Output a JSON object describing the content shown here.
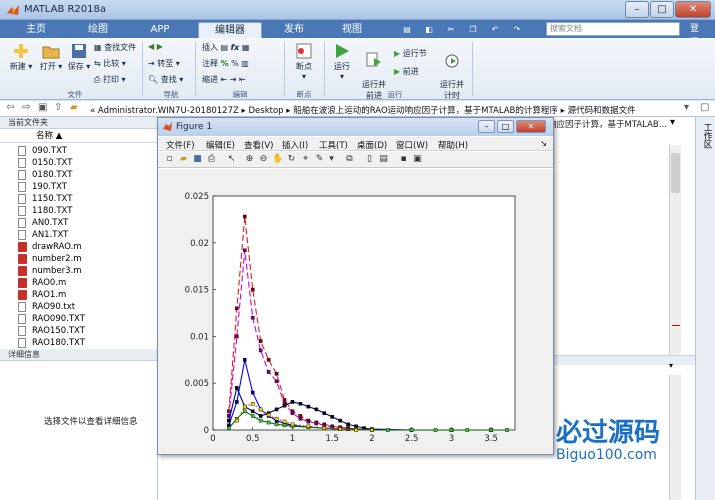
{
  "app": {
    "title": "MATLAB R2018a"
  },
  "window_buttons": {
    "minimize": "–",
    "maximize": "□",
    "close": "✕"
  },
  "ribbon_tabs": [
    "主页",
    "绘图",
    "APP",
    "编辑器",
    "发布",
    "视图"
  ],
  "active_tab": "编辑器",
  "search": {
    "placeholder": "搜索文档"
  },
  "login": "登录",
  "ribbon": {
    "new": "新建",
    "open": "打开",
    "save": "保存",
    "find_files": "查找文件",
    "compare": "比较",
    "print": "打印",
    "goto": "转至",
    "find": "查找",
    "insert": "插入",
    "comment": "注释",
    "indent": "缩进",
    "breakpoints": "断点",
    "run": "运行",
    "run_advance": "运行并\n前进",
    "run_section": "运行节",
    "advance": "前进",
    "run_time": "运行并\n计时",
    "groups": {
      "file": "文件",
      "nav": "导航",
      "edit": "编辑",
      "bp": "断点",
      "run": "运行"
    }
  },
  "address": {
    "path": "«  Administrator.WIN7U-20180127Z  ▸  Desktop  ▸  船舶在波浪上运动的RAO运动响应因子计算，基于MTALAB的计算程序  ▸  源代码和数据文件"
  },
  "left_panel": {
    "header": "当前文件夹",
    "column": "名称 ▲",
    "files": [
      {
        "name": "090.TXT",
        "type": "txt"
      },
      {
        "name": "0150.TXT",
        "type": "txt"
      },
      {
        "name": "0180.TXT",
        "type": "txt"
      },
      {
        "name": "190.TXT",
        "type": "txt"
      },
      {
        "name": "1150.TXT",
        "type": "txt"
      },
      {
        "name": "1180.TXT",
        "type": "txt"
      },
      {
        "name": "AN0.TXT",
        "type": "txt"
      },
      {
        "name": "AN1.TXT",
        "type": "txt"
      },
      {
        "name": "drawRAO.m",
        "type": "m"
      },
      {
        "name": "number2.m",
        "type": "m"
      },
      {
        "name": "number3.m",
        "type": "m"
      },
      {
        "name": "RAO0.m",
        "type": "m"
      },
      {
        "name": "RAO1.m",
        "type": "m"
      },
      {
        "name": "RAO90.txt",
        "type": "txt"
      },
      {
        "name": "RAO090.TXT",
        "type": "txt"
      },
      {
        "name": "RAO150.TXT",
        "type": "txt"
      },
      {
        "name": "RAO180.TXT",
        "type": "txt"
      }
    ],
    "details_header": "详细信息",
    "details_message": "选择文件以查看详细信息"
  },
  "editor_tab_title": "响应因子计算，基于MTALAB...",
  "right_bar": {
    "label": "工作区"
  },
  "figure": {
    "title": "Figure 1",
    "menu": [
      "文件(F)",
      "编辑(E)",
      "查看(V)",
      "插入(I)",
      "工具(T)",
      "桌面(D)",
      "窗口(W)",
      "帮助(H)"
    ]
  },
  "chart_data": {
    "type": "line",
    "xlim": [
      0,
      3.8
    ],
    "ylim": [
      0,
      0.025
    ],
    "xticks": [
      "0",
      "0.5",
      "1",
      "1.5",
      "2",
      "2.5",
      "3",
      "3.5"
    ],
    "yticks": [
      "0",
      "0.005",
      "0.01",
      "0.015",
      "0.02",
      "0.025"
    ],
    "grid": false,
    "series": [
      {
        "color": "#e41a1c",
        "dash": "6,3",
        "marker": "#8b0000",
        "x": [
          0.2,
          0.3,
          0.4,
          0.5,
          0.6,
          0.7,
          0.8,
          0.9,
          1.0,
          1.1,
          1.2,
          1.3,
          1.4,
          1.5,
          1.6,
          1.7,
          1.8,
          2.0,
          2.5,
          3.0,
          3.5
        ],
        "y": [
          0.002,
          0.013,
          0.0228,
          0.015,
          0.0095,
          0.0075,
          0.006,
          0.0032,
          0.002,
          0.0015,
          0.001,
          0.0008,
          0.0006,
          0.0004,
          0.0003,
          0.0002,
          0.0001,
          0,
          0,
          0,
          0
        ]
      },
      {
        "color": "#cc00cc",
        "dash": "6,3",
        "marker": "#7a0070",
        "x": [
          0.2,
          0.3,
          0.4,
          0.5,
          0.6,
          0.7,
          0.8,
          0.9,
          1.0,
          1.1,
          1.2,
          1.3,
          1.4,
          1.5,
          1.6,
          1.7,
          1.8,
          2.0,
          2.5,
          3.0,
          3.5
        ],
        "y": [
          0.0015,
          0.01,
          0.0192,
          0.012,
          0.0085,
          0.0062,
          0.0052,
          0.0028,
          0.0018,
          0.0012,
          0.0009,
          0.0007,
          0.0005,
          0.0003,
          0.0002,
          0.0001,
          0.0001,
          0,
          0,
          0,
          0
        ]
      },
      {
        "color": "#0000ff",
        "dash": "",
        "marker": "#000080",
        "x": [
          0.2,
          0.3,
          0.4,
          0.5,
          0.6,
          0.7,
          0.8,
          0.9,
          1.0,
          1.2,
          1.4,
          1.6,
          1.8,
          2.0,
          2.5,
          3.0,
          3.5
        ],
        "y": [
          0.0005,
          0.003,
          0.0075,
          0.004,
          0.0022,
          0.0015,
          0.001,
          0.0007,
          0.0005,
          0.0003,
          0.0002,
          0.0001,
          0.0001,
          0,
          0,
          0,
          0
        ]
      },
      {
        "color": "#000080",
        "dash": "",
        "marker": "#000000",
        "x": [
          0.2,
          0.3,
          0.4,
          0.5,
          0.6,
          0.7,
          0.8,
          0.9,
          1.0,
          1.1,
          1.2,
          1.3,
          1.4,
          1.5,
          1.6,
          1.7,
          1.8,
          1.9,
          2.0,
          2.5,
          3.0,
          3.5
        ],
        "y": [
          0.001,
          0.0045,
          0.0025,
          0.002,
          0.0015,
          0.0018,
          0.0022,
          0.0026,
          0.003,
          0.0028,
          0.0025,
          0.0022,
          0.0018,
          0.0014,
          0.001,
          0.0006,
          0.0004,
          0.0002,
          0.0001,
          0,
          0,
          0
        ]
      },
      {
        "color": "#006400",
        "dash": "",
        "marker": "#33cc33",
        "x": [
          0.2,
          0.3,
          0.4,
          0.5,
          0.6,
          0.7,
          0.8,
          0.9,
          1.0,
          1.2,
          1.4,
          1.6,
          1.8,
          2.0,
          2.2,
          2.5,
          2.8,
          3.0,
          3.2,
          3.5,
          3.7
        ],
        "y": [
          0.0002,
          0.0012,
          0.002,
          0.0015,
          0.001,
          0.0008,
          0.0006,
          0.0005,
          0.0004,
          0.0003,
          0.0002,
          0.0001,
          0.0001,
          0,
          0,
          0,
          0,
          0,
          0,
          0,
          0
        ]
      },
      {
        "color": "#996600",
        "dash": "2,2",
        "marker": "#ffcc00",
        "x": [
          0.3,
          0.4,
          0.5,
          0.6,
          0.7,
          0.8,
          0.9,
          1.0,
          1.2,
          1.4,
          1.6,
          1.8,
          2.0
        ],
        "y": [
          0.001,
          0.0025,
          0.0028,
          0.0022,
          0.0016,
          0.0012,
          0.0009,
          0.0006,
          0.0004,
          0.0002,
          0.0001,
          0,
          0
        ]
      }
    ]
  }
}
